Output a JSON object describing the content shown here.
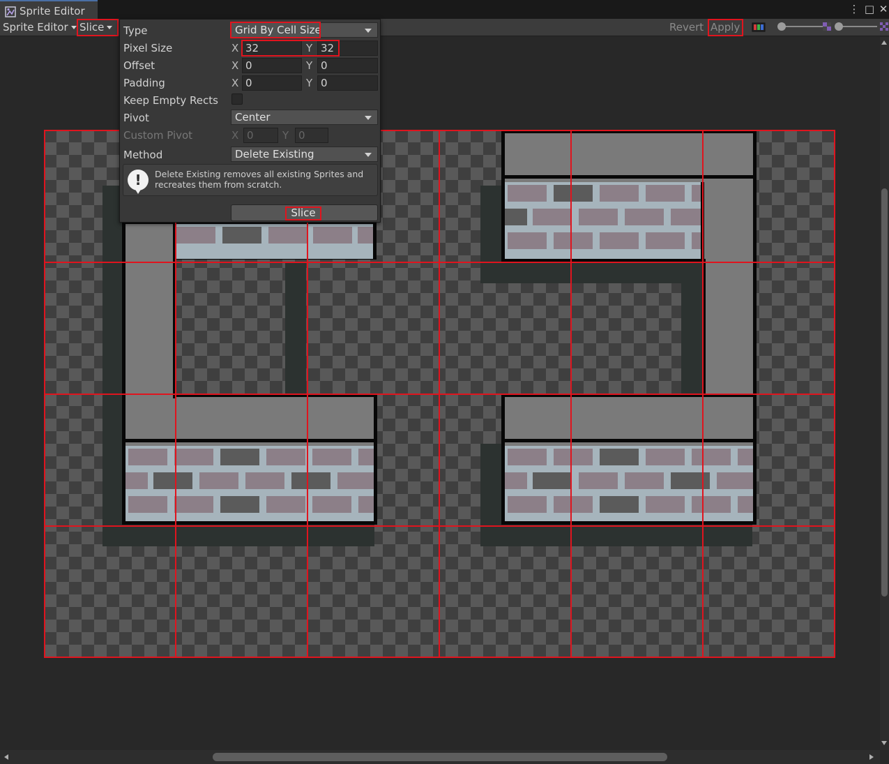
{
  "window": {
    "title": "Sprite Editor",
    "more_glyph": "⋮",
    "maximize_glyph": "□",
    "close_glyph": "✕"
  },
  "toolbar": {
    "mode_label": "Sprite Editor",
    "slice_label": "Slice",
    "revert_label": "Revert",
    "apply_label": "Apply"
  },
  "slice_popup": {
    "type_label": "Type",
    "type_value": "Grid By Cell Size",
    "pixel_size_label": "Pixel Size",
    "pixel_size_x": "32",
    "pixel_size_y": "32",
    "offset_label": "Offset",
    "offset_x": "0",
    "offset_y": "0",
    "padding_label": "Padding",
    "padding_x": "0",
    "padding_y": "0",
    "keep_empty_label": "Keep Empty Rects",
    "keep_empty_checked": false,
    "pivot_label": "Pivot",
    "pivot_value": "Center",
    "custom_pivot_label": "Custom Pivot",
    "custom_pivot_x": "0",
    "custom_pivot_y": "0",
    "method_label": "Method",
    "method_value": "Delete Existing",
    "info_text": "Delete Existing removes all existing Sprites and recreates them from scratch.",
    "info_icon_glyph": "!",
    "slice_button_label": "Slice",
    "x_label": "X",
    "y_label": "Y"
  },
  "colors": {
    "highlight": "#e0141e",
    "slice_grid": "#e0141e",
    "background": "#282828"
  },
  "sprite_grid": {
    "columns": 6,
    "rows": 4
  }
}
